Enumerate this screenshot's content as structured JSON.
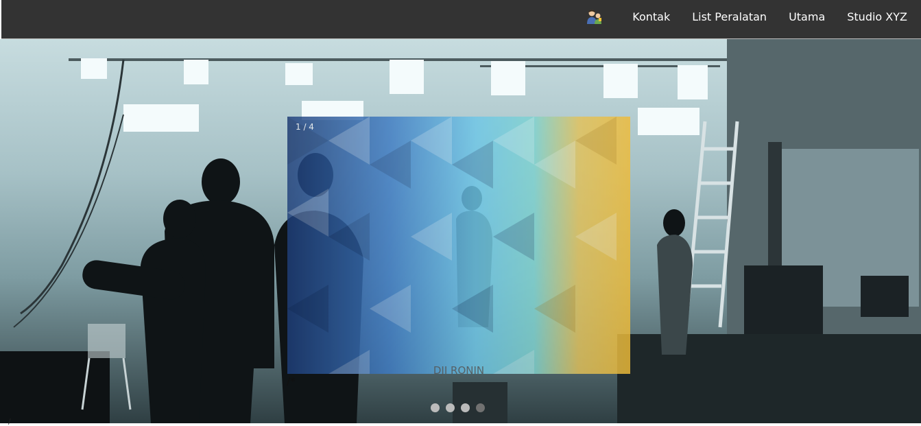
{
  "navbar": {
    "icon_name": "people-icon",
    "items": [
      {
        "label": "Kontak"
      },
      {
        "label": "List Peralatan"
      },
      {
        "label": "Utama"
      },
      {
        "label": "Studio XYZ"
      }
    ]
  },
  "slideshow": {
    "counter": "1 / 4",
    "caption": "DJI RONIN",
    "prev_label": "/*",
    "dots": [
      {
        "state": "inactive"
      },
      {
        "state": "inactive"
      },
      {
        "state": "inactive"
      },
      {
        "state": "active"
      }
    ]
  },
  "footer": {
    "mark": "/"
  },
  "colors": {
    "navbar_bg": "#333333",
    "nav_text": "#ffffff",
    "dot_inactive": "#bbbbbb",
    "dot_active": "#717171"
  }
}
